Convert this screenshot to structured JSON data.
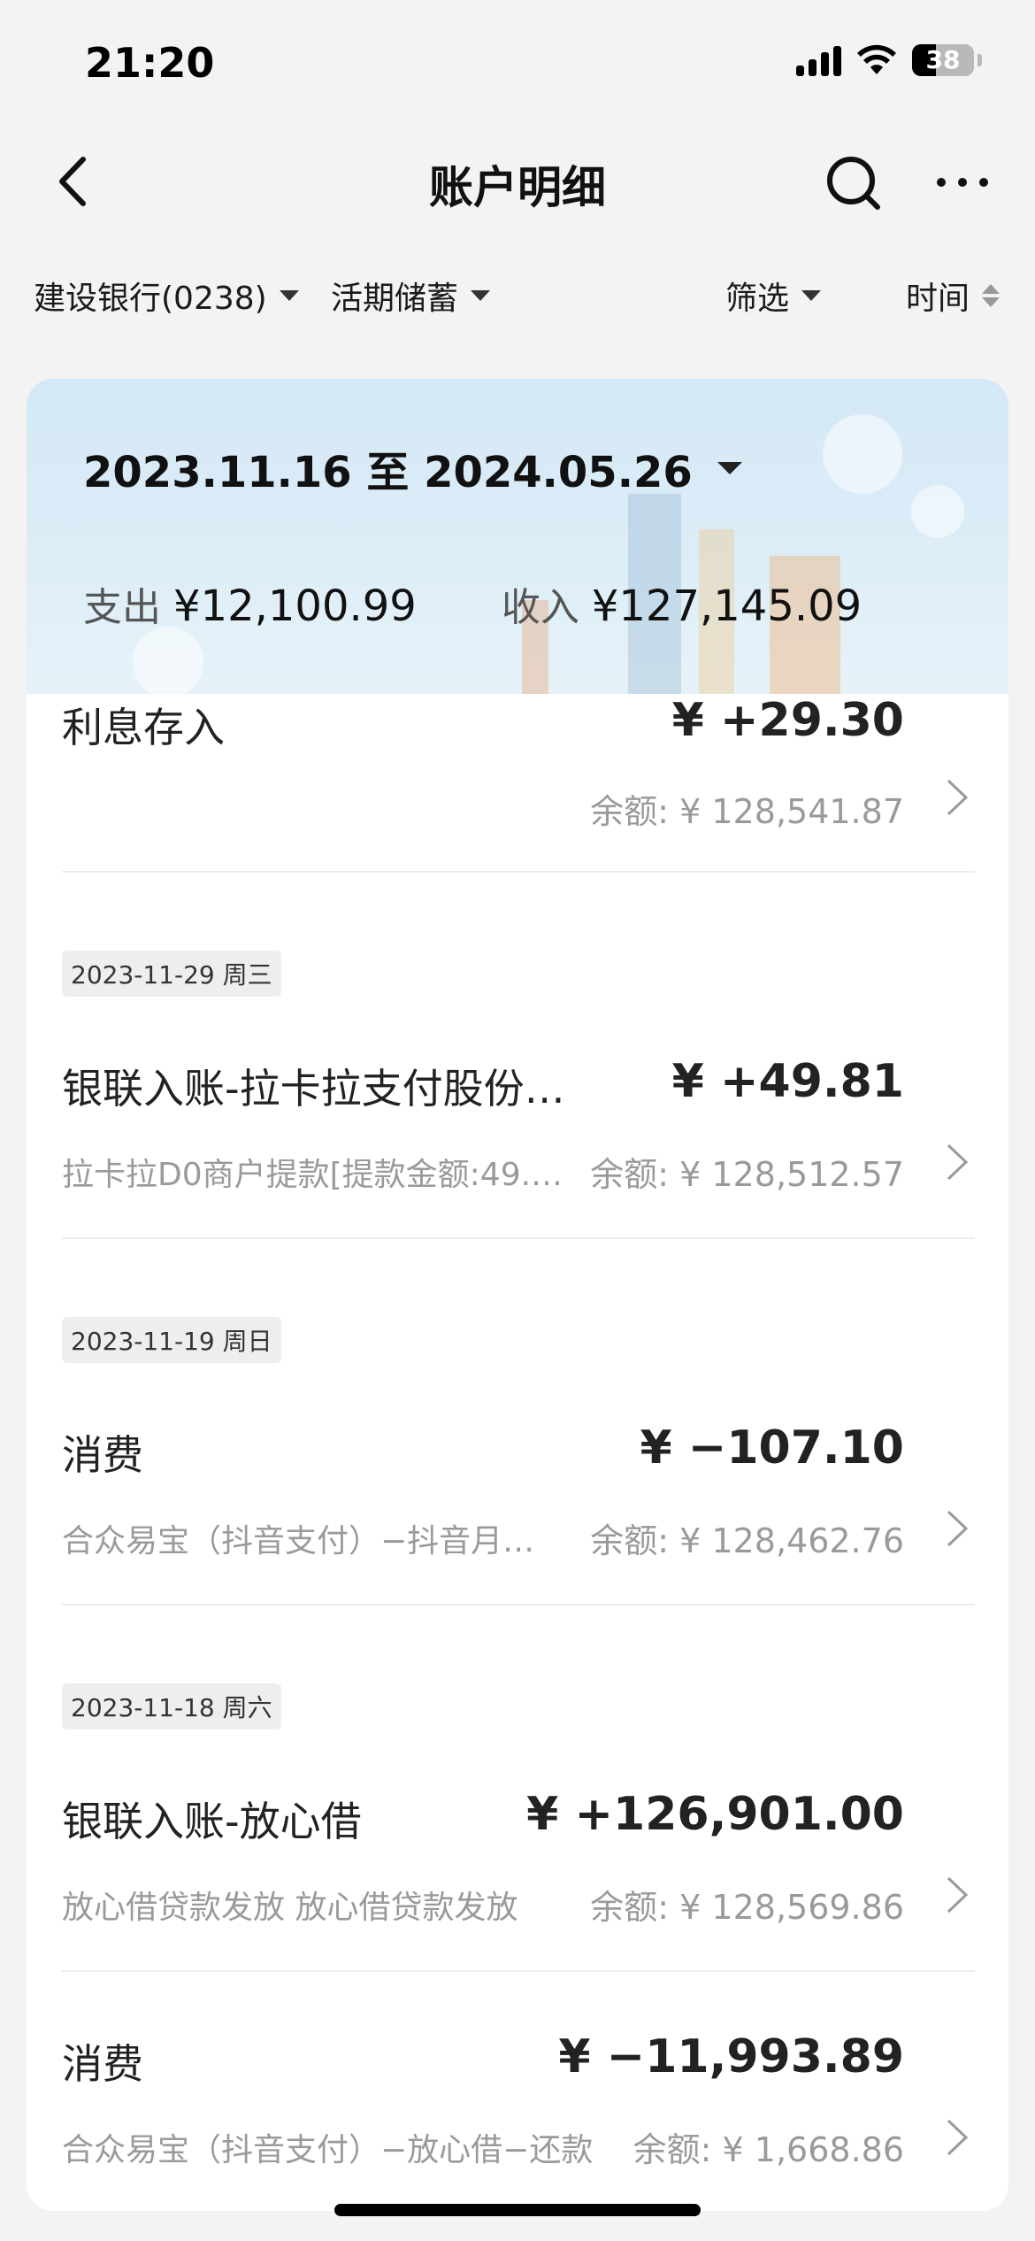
{
  "status_bar": {
    "time": "21:20",
    "battery": "38",
    "battery_level": 0.38
  },
  "nav": {
    "title": "账户明细"
  },
  "filters": {
    "account": "建设银行(0238)",
    "deposit_type": "活期储蓄",
    "screen": "筛选",
    "time": "时间"
  },
  "summary": {
    "date_range": "2023.11.16 至 2024.05.26",
    "expense_label": "支出",
    "expense": "¥12,100.99",
    "income_label": "收入",
    "income": "¥127,145.09"
  },
  "transactions": [
    {
      "title": "利息存入",
      "amount": "¥ +29.30",
      "desc": "",
      "balance": "余额: ¥ 128,541.87"
    },
    {
      "date": "2023-11-29 周三",
      "title": "银联入账-拉卡拉支付股份…",
      "amount": "¥ +49.81",
      "desc": "拉卡拉D0商户提款[提款金额:49.…",
      "balance": "余额: ¥ 128,512.57"
    },
    {
      "date": "2023-11-19 周日",
      "title": "消费",
      "amount": "¥ −107.10",
      "desc": "合众易宝（抖音支付）−抖音月…",
      "balance": "余额: ¥ 128,462.76"
    },
    {
      "date": "2023-11-18 周六",
      "title": "银联入账-放心借",
      "amount": "¥ +126,901.00",
      "desc": "放心借贷款发放 放心借贷款发放",
      "balance": "余额: ¥ 128,569.86"
    },
    {
      "title": "消费",
      "amount": "¥ −11,993.89",
      "desc": "合众易宝（抖音支付）−放心借−还款",
      "balance": "余额: ¥ 1,668.86"
    }
  ]
}
